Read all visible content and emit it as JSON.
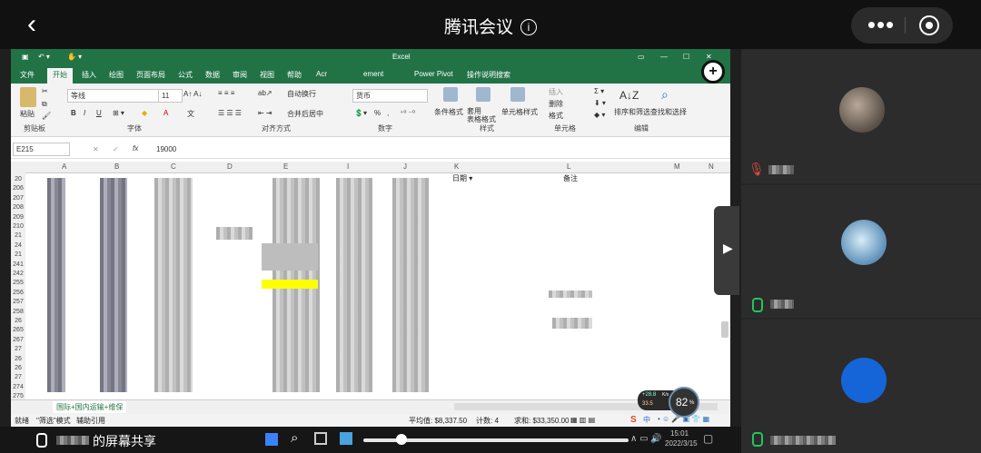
{
  "topbar": {
    "back_glyph": "‹",
    "title": "腾讯会议",
    "info_glyph": "i",
    "more_glyph": "•••"
  },
  "excel": {
    "title": "Excel",
    "tabs": [
      "文件",
      "开始",
      "插入",
      "绘图",
      "页面布局",
      "公式",
      "数据",
      "审阅",
      "视图",
      "帮助",
      "Acr",
      "ement",
      "Power Pivot",
      "操作说明搜索"
    ],
    "active_tab": "开始",
    "ribbon": {
      "paste": "粘贴",
      "font_name": "等线",
      "font_size": "11",
      "wrap": "自动换行",
      "merge": "合并后居中",
      "num_format": "货币",
      "cond_format": "条件格式",
      "table_format": "套用\n表格格式",
      "cell_style": "单元格样式",
      "insert": "插入",
      "delete": "删除",
      "format": "格式",
      "sort": "排序和筛选",
      "find": "查找和选择",
      "groups": [
        "剪贴板",
        "字体",
        "对齐方式",
        "数字",
        "样式",
        "单元格",
        "编辑"
      ],
      "bold": "B",
      "italic": "I",
      "underline": "U",
      "percent": "%"
    },
    "name_box": "E215",
    "formula": "19000",
    "fx": "fx",
    "columns": [
      "A",
      "B",
      "C",
      "D",
      "E",
      "I",
      "J",
      "K",
      "L",
      "M",
      "N"
    ],
    "col_k_label": "日期",
    "col_l_label": "备注",
    "rows": [
      "20",
      "206",
      "207",
      "208",
      "209",
      "210",
      "21",
      "24",
      "21",
      "241",
      "242",
      "255",
      "256",
      "257",
      "258",
      "26",
      "265",
      "267",
      "27",
      "26",
      "26",
      "27",
      "274",
      "275"
    ],
    "sheet_tab": "国际+国内运输+维保",
    "status_left": "就绪",
    "status_mid": "\"筛选\"模式",
    "status_acc": "辅助引用",
    "avg": "平均值: $8,337.50",
    "count": "计数: 4",
    "sum": "求和: $33,350.00",
    "net_up": "+28.8",
    "net_down": "33.5",
    "net_unit": "K/s",
    "cpu": "82",
    "cpu_unit": "%",
    "ime": "中",
    "clock_time": "15:01",
    "clock_date": "2022/3/15"
  },
  "bottom": {
    "share_label": "的屏幕共享"
  },
  "participants": [
    {
      "name": "v?",
      "muted": true
    },
    {
      "name": "F",
      "muted": false
    },
    {
      "name": "",
      "muted": false
    }
  ],
  "colors": {
    "excel_green": "#217346",
    "highlight_yellow": "#ffff00",
    "mic_green": "#22c55e",
    "mute_red": "#e64545"
  }
}
